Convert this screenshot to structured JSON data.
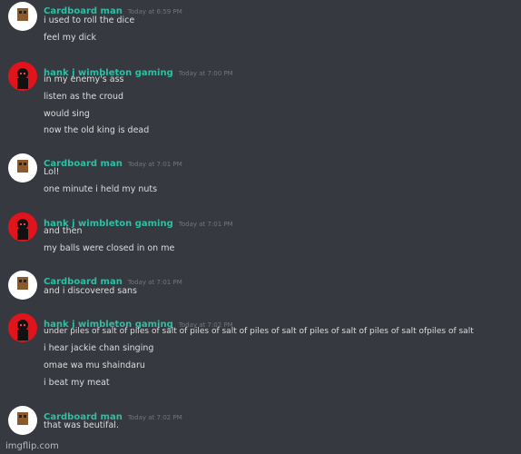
{
  "messages": [
    {
      "type": "cardboard",
      "username": "Cardboard man",
      "timestamp": "Today at 6:59 PM",
      "lines": [
        "i used to roll the dice",
        "feel my dick"
      ]
    },
    {
      "type": "hank",
      "username": "hank j wimbleton gaming",
      "timestamp": "Today at 7:00 PM",
      "lines": [
        "in my enemy's ass",
        "listen as the croud",
        "would sing",
        "now the old king is dead"
      ]
    },
    {
      "type": "cardboard",
      "username": "Cardboard man",
      "timestamp": "Today at 7:01 PM",
      "lines": [
        "Lol!",
        "one minute i held my nuts"
      ]
    },
    {
      "type": "hank",
      "username": "hank j wimbleton gaming",
      "timestamp": "Today at 7:01 PM",
      "lines": [
        "and then",
        "my balls were closed in on me"
      ]
    },
    {
      "type": "cardboard",
      "username": "Cardboard man",
      "timestamp": "Today at 7:01 PM",
      "lines": [
        "and i discovered sans"
      ]
    },
    {
      "type": "hank",
      "username": "hank j wimbleton gaming",
      "timestamp": "Today at 7:02 PM",
      "lines": [
        "under piles of salt of piles of salt of piles of salt of piles of salt of piles of salt of piles of salt ofpiles of salt",
        "i hear jackie chan singing",
        "omae wa mu shaindaru",
        "i beat my meat"
      ]
    },
    {
      "type": "cardboard",
      "username": "Cardboard man",
      "timestamp": "Today at 7:02 PM",
      "lines": [
        "that was beutifal."
      ]
    }
  ],
  "watermark": "imgflip.com",
  "colors": {
    "background": "#36393f",
    "username": "#2fbfa5",
    "text": "#dcddde",
    "timestamp": "#72767d",
    "hank_avatar": "#e0141a"
  }
}
